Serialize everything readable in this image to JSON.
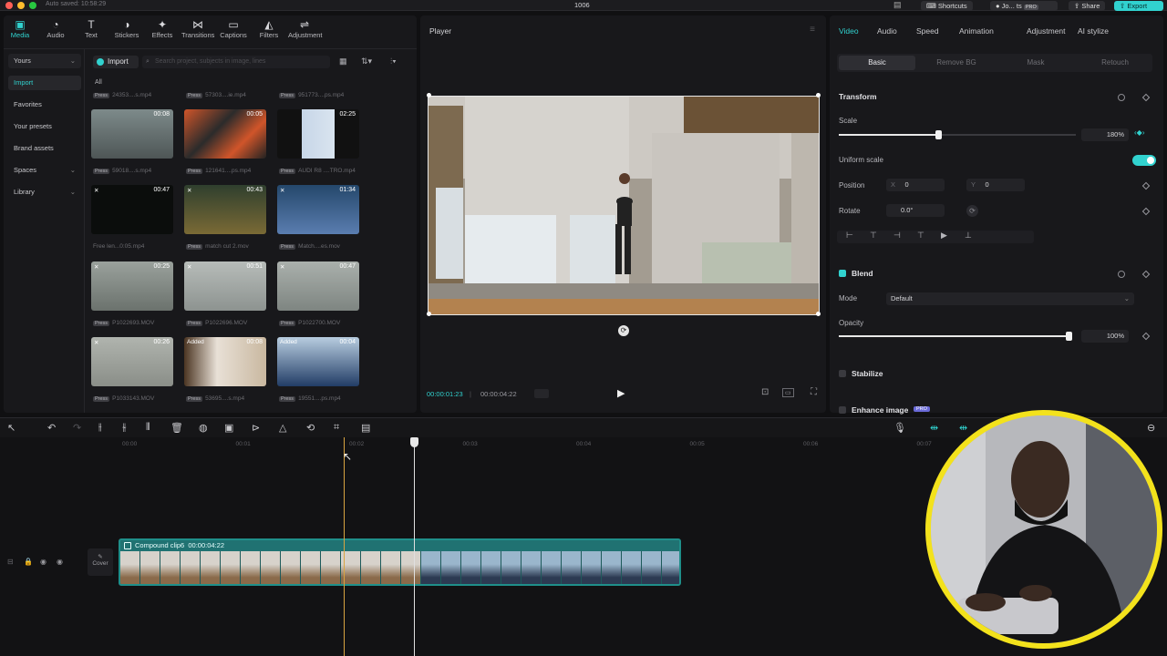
{
  "titlebar": {
    "autosave": "Auto saved: 10:58:29",
    "project_name": "1006",
    "shortcuts": "Shortcuts",
    "user": "Jo... ts",
    "pro_badge": "PRO",
    "share": "Share",
    "export": "Export"
  },
  "toolbar": {
    "items": [
      {
        "label": "Media",
        "icon": "media-icon"
      },
      {
        "label": "Audio",
        "icon": "audio-icon"
      },
      {
        "label": "Text",
        "icon": "text-icon"
      },
      {
        "label": "Stickers",
        "icon": "stickers-icon"
      },
      {
        "label": "Effects",
        "icon": "effects-icon"
      },
      {
        "label": "Transitions",
        "icon": "transitions-icon"
      },
      {
        "label": "Captions",
        "icon": "captions-icon"
      },
      {
        "label": "Filters",
        "icon": "filters-icon"
      },
      {
        "label": "Adjustment",
        "icon": "adjustment-icon"
      }
    ]
  },
  "media_sidebar": {
    "items": [
      "Yours",
      "Import",
      "Favorites",
      "Your presets",
      "Brand assets",
      "Spaces",
      "Library"
    ]
  },
  "media": {
    "import_label": "Import",
    "search_placeholder": "Search project, subjects in image, lines",
    "filter_all": "All",
    "top_captions": [
      "24353....s.mp4",
      "57303....ie.mp4",
      "951773....ps.mp4"
    ],
    "rows": [
      [
        {
          "duration": "00:08",
          "caption": "59018....s.mp4",
          "added": ""
        },
        {
          "duration": "00:05",
          "caption": "121641....ps.mp4",
          "added": ""
        },
        {
          "duration": "02:25",
          "caption": "AUDI R8 ....TRO.mp4",
          "added": ""
        }
      ],
      [
        {
          "duration": "00:47",
          "caption": "Free len...0:05.mp4",
          "added": ""
        },
        {
          "duration": "00:43",
          "caption": "match cut 2.mov",
          "added": ""
        },
        {
          "duration": "01:34",
          "caption": "Match....es.mov",
          "added": ""
        }
      ],
      [
        {
          "duration": "00:25",
          "caption": "P1022693.MOV",
          "added": ""
        },
        {
          "duration": "00:51",
          "caption": "P1022696.MOV",
          "added": ""
        },
        {
          "duration": "00:47",
          "caption": "P1022700.MOV",
          "added": ""
        }
      ],
      [
        {
          "duration": "00:26",
          "caption": "P1033143.MOV",
          "added": ""
        },
        {
          "duration": "00:08",
          "caption": "53695....s.mp4",
          "added": "Added"
        },
        {
          "duration": "00:04",
          "caption": "19551....ps.mp4",
          "added": "Added"
        }
      ]
    ],
    "press_tag": "Press"
  },
  "player": {
    "title": "Player",
    "current_time": "00:00:01:23",
    "total_time": "00:00:04:22"
  },
  "props": {
    "tabs": [
      "Video",
      "Audio",
      "Speed",
      "Animation",
      "Adjustment",
      "AI stylize"
    ],
    "subtabs": [
      "Basic",
      "Remove BG",
      "Mask",
      "Retouch"
    ],
    "transform": "Transform",
    "scale_label": "Scale",
    "scale_value": "180%",
    "scale_fraction": 0.42,
    "uniform_scale": "Uniform scale",
    "position_label": "Position",
    "pos_x_label": "X",
    "pos_x": "0",
    "pos_y_label": "Y",
    "pos_y": "0",
    "rotate_label": "Rotate",
    "rotate_value": "0.0°",
    "blend": "Blend",
    "mode_label": "Mode",
    "mode_value": "Default",
    "opacity_label": "Opacity",
    "opacity_value": "100%",
    "opacity_fraction": 1.0,
    "stabilize": "Stabilize",
    "enhance_image": "Enhance image",
    "enhance_badge": "PRO"
  },
  "timeline": {
    "ticks": [
      "00:00",
      "00:01",
      "00:02",
      "00:03",
      "00:04",
      "00:05",
      "00:06",
      "00:07"
    ],
    "clip_name": "Compound clip6",
    "clip_duration": "00:00:04:22",
    "cover_label": "Cover"
  },
  "colors": {
    "accent": "#31d2cf",
    "clip_border": "#1f8f8a",
    "panel": "#18181b",
    "playhead_hover": "#d9a441",
    "webcam_ring": "#f3e21c"
  }
}
